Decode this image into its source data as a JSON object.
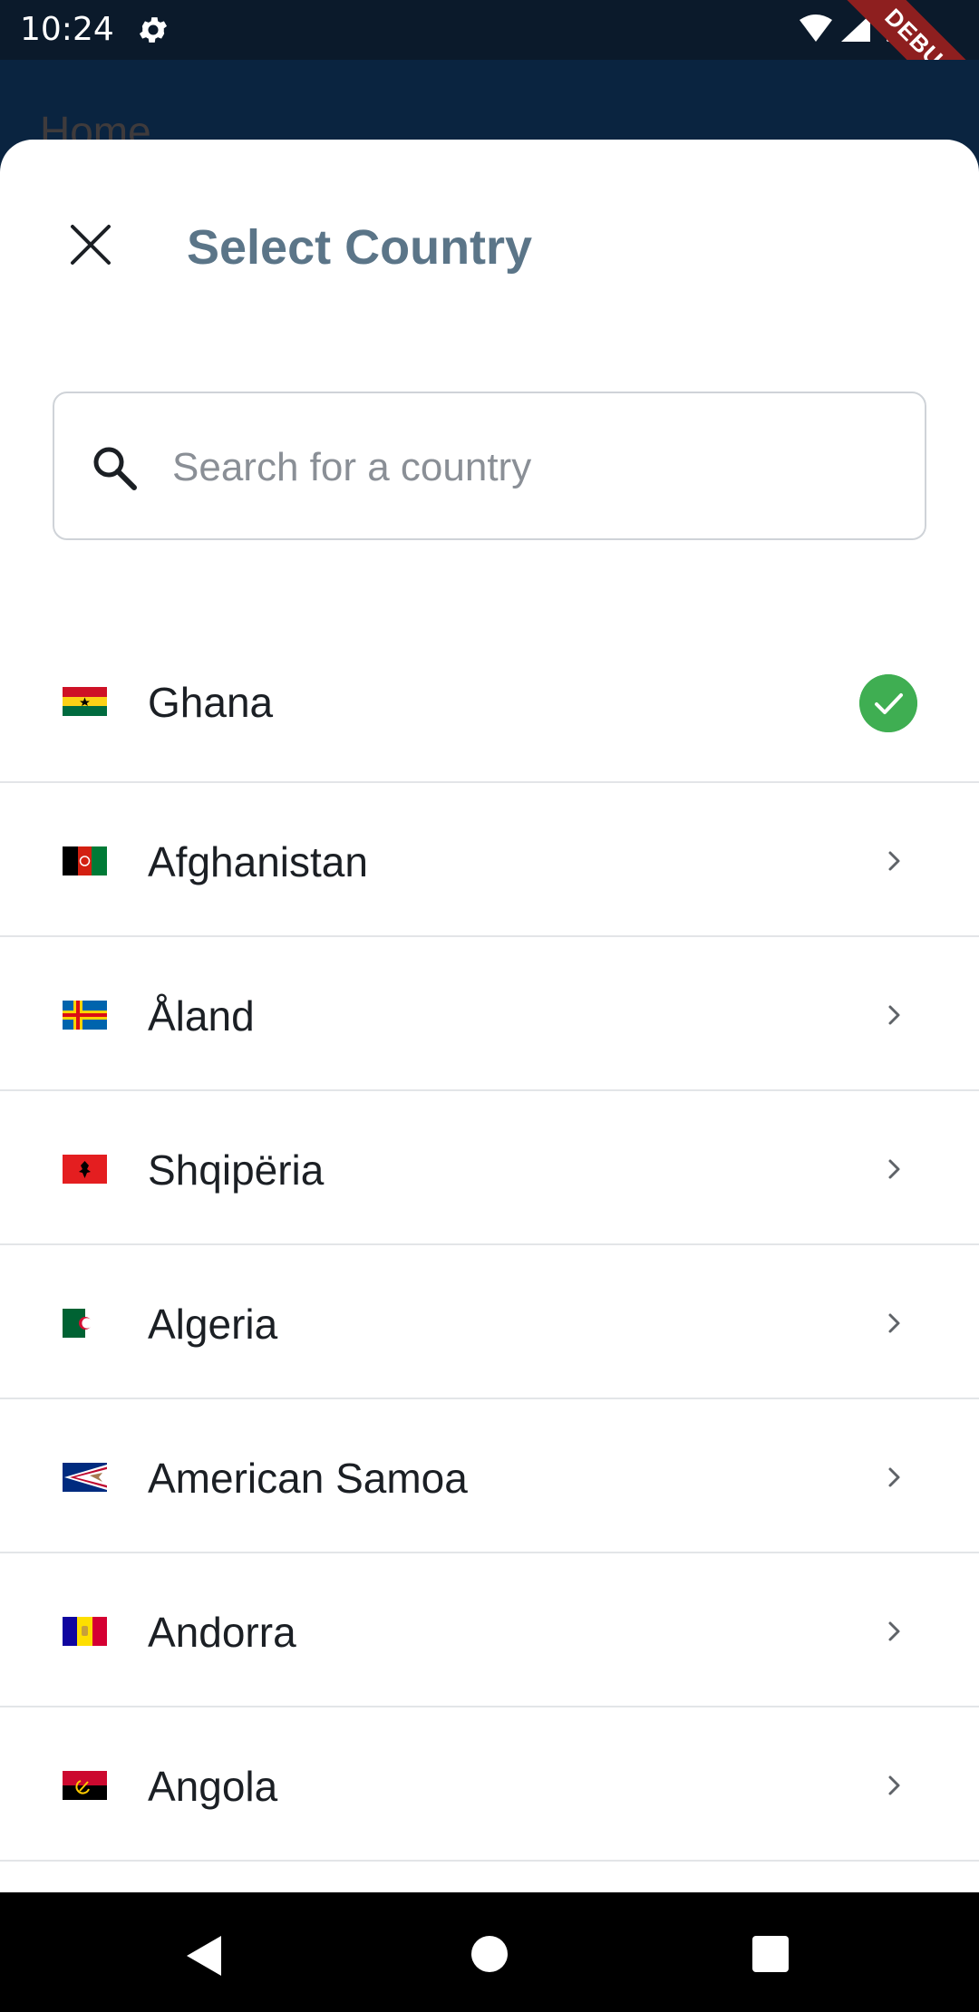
{
  "status_bar": {
    "time": "10:24",
    "debug_label": "DEBUG"
  },
  "app_bar": {
    "title": "Home"
  },
  "sheet": {
    "title": "Select Country",
    "search": {
      "placeholder": "Search for a country",
      "value": ""
    }
  },
  "countries": [
    {
      "name": "Ghana",
      "selected": true,
      "flag": "ghana-flag"
    },
    {
      "name": "Afghanistan",
      "selected": false,
      "flag": "afghanistan-flag"
    },
    {
      "name": "Åland",
      "selected": false,
      "flag": "aland-flag"
    },
    {
      "name": "Shqipëria",
      "selected": false,
      "flag": "albania-flag"
    },
    {
      "name": "Algeria",
      "selected": false,
      "flag": "algeria-flag"
    },
    {
      "name": "American Samoa",
      "selected": false,
      "flag": "american-samoa-flag"
    },
    {
      "name": "Andorra",
      "selected": false,
      "flag": "andorra-flag"
    },
    {
      "name": "Angola",
      "selected": false,
      "flag": "angola-flag"
    }
  ],
  "colors": {
    "accent_check": "#3fae52",
    "title": "#5b7588",
    "status_bar": "#0b1a2b",
    "app_bar": "#0a2440"
  },
  "icons": {
    "close": "close-icon",
    "search": "search-icon",
    "chevron": "chevron-right-icon",
    "check": "check-circle-icon"
  }
}
